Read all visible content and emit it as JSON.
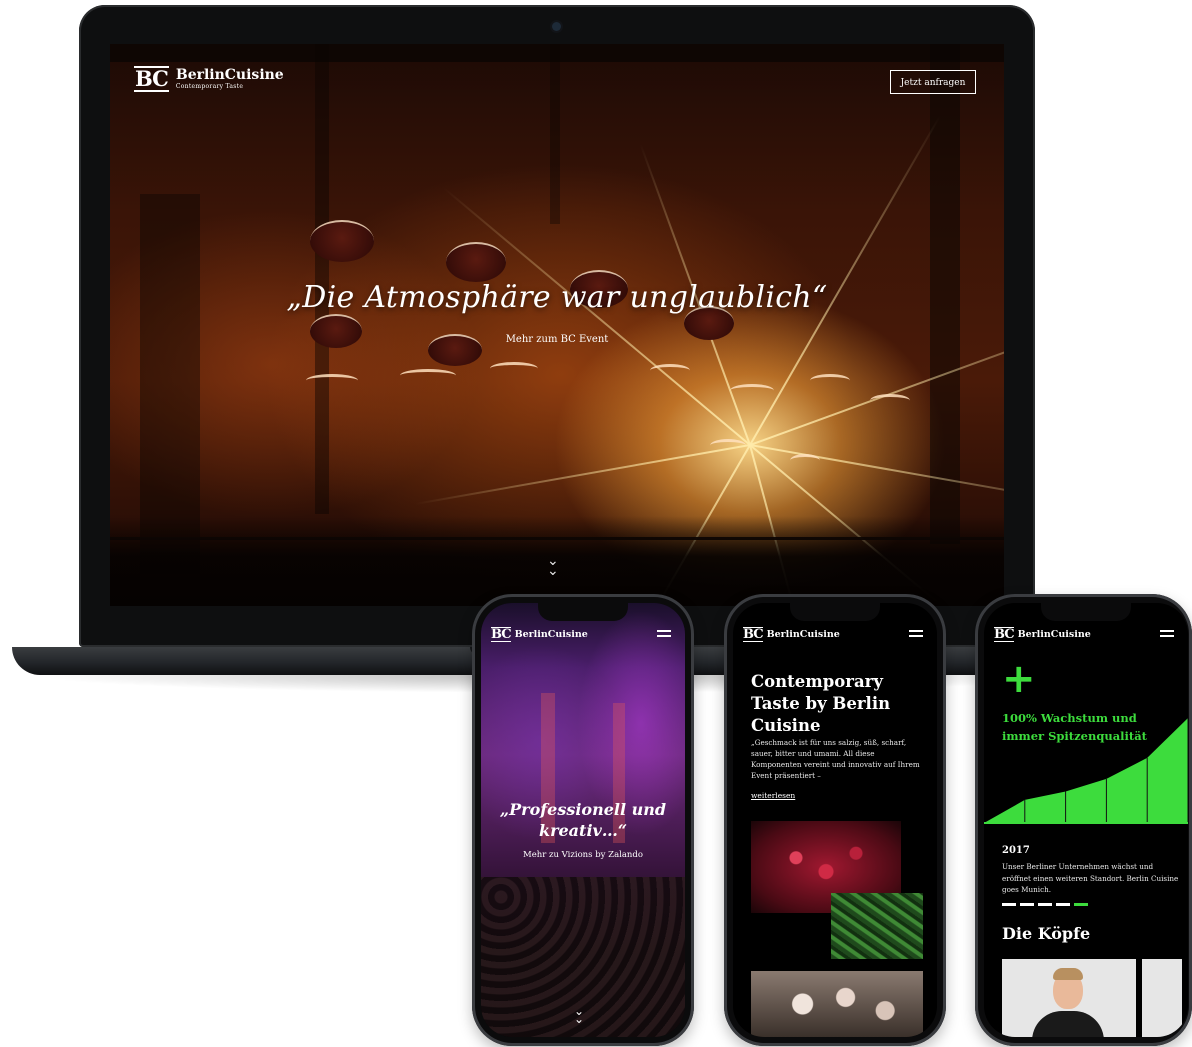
{
  "laptop": {
    "brand": {
      "mark": "BC",
      "name": "BerlinCuisine",
      "tagline": "Contemporary Taste"
    },
    "cta_label": "Jetzt anfragen",
    "hero_quote": "„Die Atmosphäre war unglaublich“",
    "hero_link": "Mehr zum BC Event",
    "scroll_icon": "double-chevron-down"
  },
  "phone1": {
    "brand": {
      "mark": "BC",
      "name": "BerlinCuisine"
    },
    "quote": "„Professionell und kreativ…“",
    "link": "Mehr zu Vizions by Zalando",
    "scroll_icon": "double-chevron-down"
  },
  "phone2": {
    "brand": {
      "mark": "BC",
      "name": "BerlinCuisine"
    },
    "title": "Contemporary Taste by Berlin Cuisine",
    "body": "„Geschmack ist für uns salzig, süß, scharf, sauer, bitter und umami. All diese Komponenten vereint und innovativ auf Ihrem Event präsentiert –",
    "link": "weiterlesen"
  },
  "phone3": {
    "brand": {
      "mark": "BC",
      "name": "BerlinCuisine"
    },
    "plus": "+",
    "headline": "100% Wachstum und immer Spitzenqualität",
    "year": "2017",
    "body": "Unser Berliner Unternehmen wächst und eröffnet einen weiteren Standort. Berlin Cuisine goes Munich.",
    "section_title": "Die Köpfe",
    "growth_chart_steps": [
      0.22,
      0.3,
      0.42,
      0.62,
      1.0
    ],
    "dash_count": 5,
    "active_dash": 4
  },
  "colors": {
    "accent_green": "#3ddc3d",
    "background_dark": "#000000",
    "text_light": "#ffffff"
  }
}
